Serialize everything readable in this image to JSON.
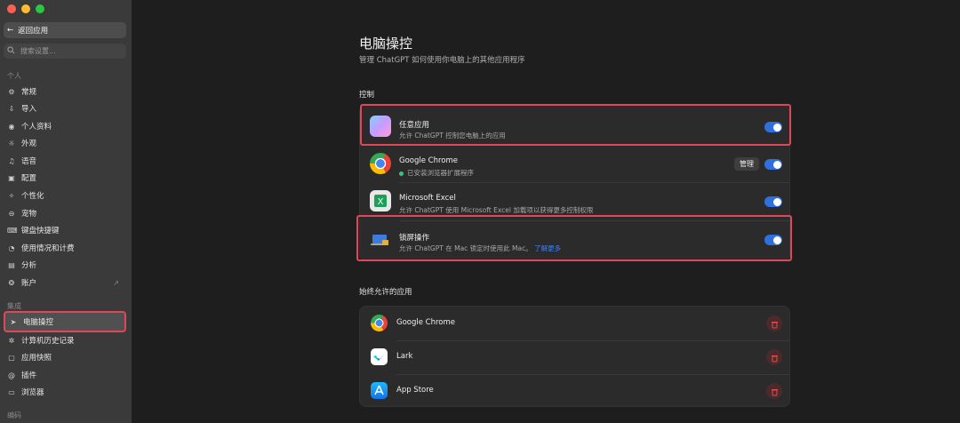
{
  "sidebar": {
    "back_label": "返回应用",
    "search_placeholder": "搜索设置...",
    "section_personal": "个人",
    "section_integration": "集成",
    "section_coding": "编码",
    "items": [
      {
        "label": "常规",
        "icon": "gear-icon"
      },
      {
        "label": "导入",
        "icon": "download-icon"
      },
      {
        "label": "个人资料",
        "icon": "person-icon"
      },
      {
        "label": "外观",
        "icon": "sun-icon"
      },
      {
        "label": "语音",
        "icon": "mic-icon"
      },
      {
        "label": "配置",
        "icon": "box-icon"
      },
      {
        "label": "个性化",
        "icon": "sparkle-icon"
      },
      {
        "label": "宠物",
        "icon": "pet-icon"
      },
      {
        "label": "键盘快捷键",
        "icon": "keyboard-icon"
      },
      {
        "label": "使用情况和计费",
        "icon": "billing-icon"
      },
      {
        "label": "分析",
        "icon": "chart-icon"
      },
      {
        "label": "账户",
        "icon": "account-icon"
      }
    ],
    "integration_items": [
      {
        "label": "电脑操控",
        "icon": "cursor-icon"
      },
      {
        "label": "计算机历史记录",
        "icon": "history-icon"
      },
      {
        "label": "应用快照",
        "icon": "snapshot-icon"
      },
      {
        "label": "插件",
        "icon": "plugin-icon"
      },
      {
        "label": "浏览器",
        "icon": "browser-icon"
      }
    ]
  },
  "main": {
    "title": "电脑操控",
    "subtitle": "管理 ChatGPT 如何使用你电脑上的其他应用程序",
    "control_label": "控制",
    "controls": [
      {
        "title": "任意应用",
        "desc": "允许 ChatGPT 控制您电脑上的应用"
      },
      {
        "title": "Google Chrome",
        "desc": "已安装浏览器扩展程序",
        "manage": "管理"
      },
      {
        "title": "Microsoft Excel",
        "desc": "允许 ChatGPT 使用 Microsoft Excel 加载项以获得更多控制权限"
      },
      {
        "title": "锁屏操作",
        "desc": "允许 ChatGPT 在 Mac 锁定时使用此 Mac。",
        "link": "了解更多"
      }
    ],
    "always_label": "始终允许的应用",
    "always_apps": [
      {
        "name": "Google Chrome"
      },
      {
        "name": "Lark"
      },
      {
        "name": "App Store"
      }
    ]
  },
  "colors": {
    "accent": "#2f6fde",
    "highlight": "#e0485a",
    "link": "#3b82f6"
  }
}
